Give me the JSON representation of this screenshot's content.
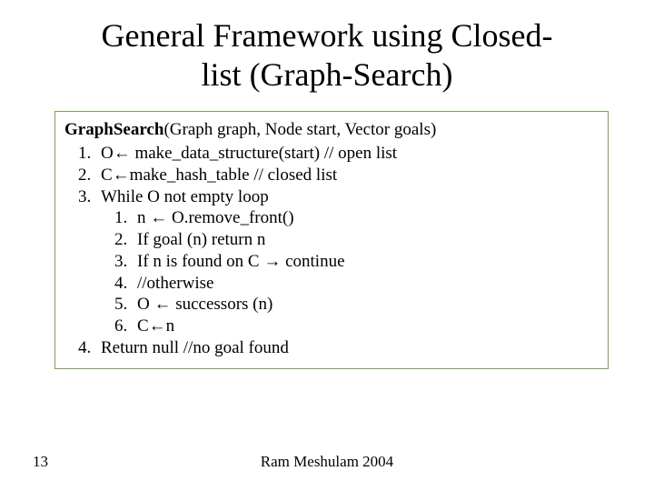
{
  "title_line1": "General Framework using Closed-",
  "title_line2": "list (Graph-Search)",
  "fn_name": "GraphSearch",
  "fn_sig": "(Graph graph, Node start, Vector goals)",
  "steps": {
    "s1": "O← make_data_structure(start) // open list",
    "s2": "C←make_hash_table // closed list",
    "s3": "While O not empty loop",
    "s3_1": "n ← O.remove_front()",
    "s3_2": "If goal (n) return n",
    "s3_3": "If n is found on C → continue",
    "s3_4": "//otherwise",
    "s3_5": "O ← successors (n)",
    "s3_6": "C←n",
    "s4": "Return null //no goal found"
  },
  "page_number": "13",
  "author_footer": "Ram Meshulam 2004"
}
